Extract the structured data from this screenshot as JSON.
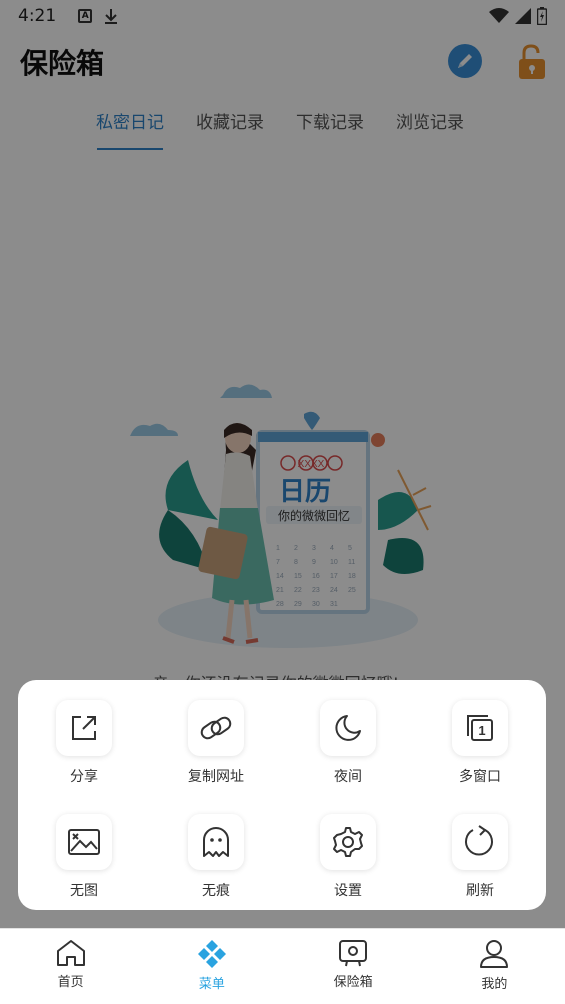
{
  "status_bar": {
    "time": "4:21"
  },
  "header": {
    "title": "保险箱"
  },
  "tabs": [
    {
      "label": "私密日记",
      "active": true
    },
    {
      "label": "收藏记录",
      "active": false
    },
    {
      "label": "下载记录",
      "active": false
    },
    {
      "label": "浏览记录",
      "active": false
    }
  ],
  "illustration": {
    "calendar_title": "日历",
    "calendar_subtitle": "你的微微回忆",
    "calendar_marks": "XXXX"
  },
  "empty_message": "亲，你还没有记录你的微微回忆哦!~",
  "menu": {
    "items": [
      {
        "label": "分享",
        "icon": "share-icon"
      },
      {
        "label": "复制网址",
        "icon": "link-icon"
      },
      {
        "label": "夜间",
        "icon": "moon-icon"
      },
      {
        "label": "多窗口",
        "icon": "multi-window-icon",
        "badge": "1"
      },
      {
        "label": "无图",
        "icon": "no-image-icon"
      },
      {
        "label": "无痕",
        "icon": "ghost-icon"
      },
      {
        "label": "设置",
        "icon": "gear-icon"
      },
      {
        "label": "刷新",
        "icon": "refresh-icon"
      }
    ]
  },
  "bottom_nav": [
    {
      "label": "首页",
      "icon": "home-icon",
      "active": false
    },
    {
      "label": "菜单",
      "icon": "menu-diamond-icon",
      "active": true
    },
    {
      "label": "保险箱",
      "icon": "safe-icon",
      "active": false
    },
    {
      "label": "我的",
      "icon": "user-icon",
      "active": false
    }
  ],
  "colors": {
    "accent": "#2f82c8",
    "nav_active": "#2aa3e0",
    "lock": "#e8912e"
  }
}
